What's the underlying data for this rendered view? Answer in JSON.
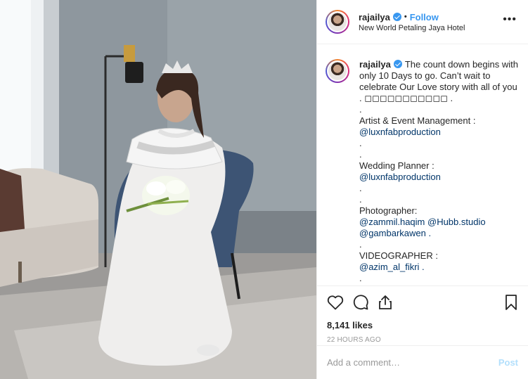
{
  "post": {
    "username": "rajailya",
    "follow_label": "Follow",
    "separator": "•",
    "location": "New World Petaling Jaya Hotel",
    "more_label": "•••",
    "caption_lines": [
      "The count down begins with only 10 Days to go. Can’t wait to celebrate Our Love story with all of you . ◻◻◻◻◻◻◻◻◻◻◻ .",
      ".",
      "Artist & Event Management :",
      "@luxnfabproduction",
      ".",
      ".",
      "Wedding Planner :",
      "@luxnfabproduction",
      ".",
      ".",
      "Photographer:",
      "@zammil.haqim @Hubb.studio",
      "@gambarkawen .",
      ".",
      "VIDEOGRAPHER :",
      "@azim_al_fikri .",
      "."
    ],
    "likes": "8,141 likes",
    "time": "22 HOURS AGO",
    "comment_placeholder": "Add a comment…",
    "post_label": "Post"
  },
  "icons": {
    "like": "heart-icon",
    "comment": "comment-icon",
    "share": "share-icon",
    "save": "bookmark-icon",
    "verified": "verified-badge-icon"
  },
  "colors": {
    "link": "#3897f0",
    "mention": "#003569",
    "muted": "#999999",
    "post_disabled": "#b2dffc"
  }
}
